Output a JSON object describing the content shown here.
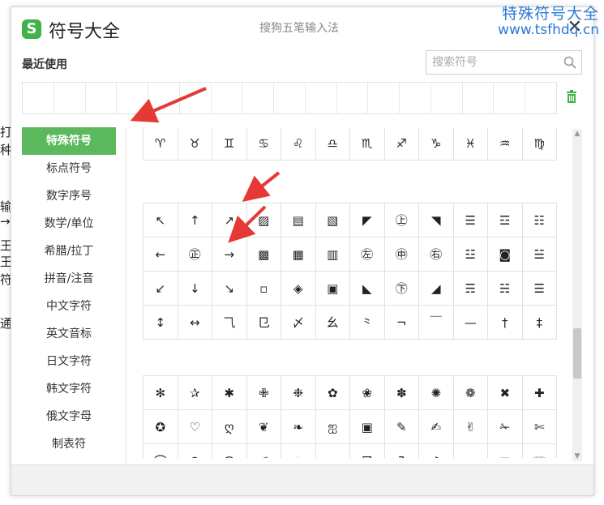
{
  "background_fragments": [
    "打",
    "种",
    "输",
    "→",
    "王",
    "王",
    "符",
    "通"
  ],
  "watermark": {
    "title": "特殊符号大全",
    "url": "www.tsfhdq.cn"
  },
  "window": {
    "app_title": "符号大全",
    "ime_name": "搜狗五笔输入法",
    "close_label": "✕",
    "recent_label": "最近使用",
    "search_placeholder": "搜索符号",
    "recent_slots": 17
  },
  "categories": [
    {
      "label": "特殊符号",
      "active": true
    },
    {
      "label": "标点符号",
      "active": false
    },
    {
      "label": "数字序号",
      "active": false
    },
    {
      "label": "数学/单位",
      "active": false
    },
    {
      "label": "希腊/拉丁",
      "active": false
    },
    {
      "label": "拼音/注音",
      "active": false
    },
    {
      "label": "中文字符",
      "active": false
    },
    {
      "label": "英文音标",
      "active": false
    },
    {
      "label": "日文字符",
      "active": false
    },
    {
      "label": "韩文字符",
      "active": false
    },
    {
      "label": "俄文字母",
      "active": false
    },
    {
      "label": "制表符",
      "active": false
    }
  ],
  "symbol_groups": [
    {
      "rows": [
        [
          "♈",
          "♉",
          "♊",
          "♋",
          "♌",
          "♎",
          "♏",
          "♐",
          "♑",
          "♓",
          "♒",
          "♍"
        ]
      ]
    },
    {
      "rows": [
        [
          "↖",
          "↑",
          "↗",
          "▨",
          "▤",
          "▧",
          "◤",
          "㊤",
          "◥",
          "☰",
          "☲",
          "☷"
        ],
        [
          "←",
          "㊣",
          "→",
          "▩",
          "▦",
          "▥",
          "㊧",
          "㊥",
          "㊨",
          "☳",
          "◙",
          "☱"
        ],
        [
          "↙",
          "↓",
          "↘",
          "▫",
          "◈",
          "▣",
          "◣",
          "㊦",
          "◢",
          "☴",
          "☵",
          "☰"
        ],
        [
          "↕",
          "↔",
          "⺄",
          "⺋",
          "〆",
          "⺓",
          "⺀",
          "¬",
          "￣",
          "—",
          "†",
          "‡"
        ]
      ]
    },
    {
      "rows": [
        [
          "✻",
          "✰",
          "✱",
          "✙",
          "❉",
          "✿",
          "❀",
          "✽",
          "✺",
          "❁",
          "✖",
          "✚"
        ],
        [
          "✪",
          "♡",
          "ღ",
          "❦",
          "❧",
          "ஐ",
          "▣",
          "✎",
          "✍",
          "✌",
          "✁",
          "✄"
        ],
        [
          "⌒",
          "☂",
          "☊",
          "✐",
          "♨",
          "‹",
          "☈",
          "ℨ",
          "♪",
          "∴",
          "✉",
          "☏"
        ]
      ]
    }
  ],
  "colors": {
    "accent": "#5cb85c",
    "watermark": "#2b79d4",
    "arrow": "#e53935"
  }
}
